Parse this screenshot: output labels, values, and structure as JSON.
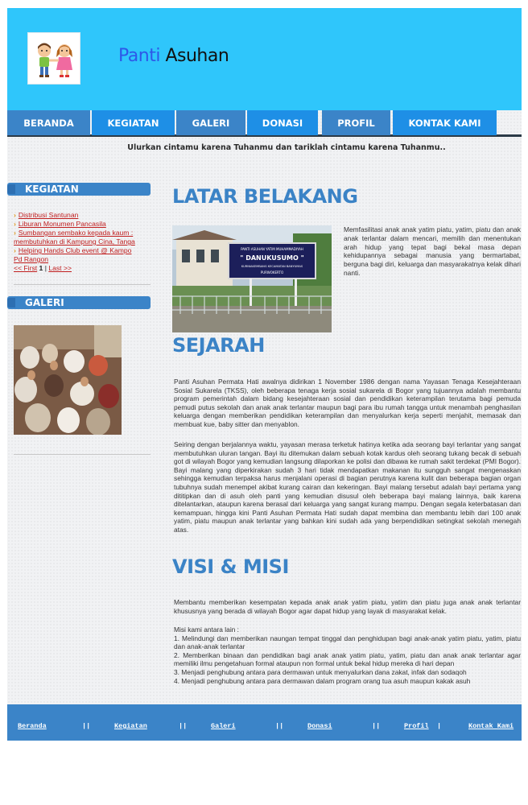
{
  "header": {
    "title_part1": "Panti",
    "title_part2": "Asuhan"
  },
  "nav": {
    "items": [
      {
        "label": "BERANDA"
      },
      {
        "label": "KEGIATAN"
      },
      {
        "label": "GALERI"
      },
      {
        "label": "DONASI"
      },
      {
        "label": "PROFIL"
      },
      {
        "label": "KONTAK KAMI"
      }
    ]
  },
  "tagline": "Ulurkan cintamu karena Tuhanmu dan tariklah cintamu karena Tuhanmu..",
  "sidebar": {
    "kegiatan_heading": "KEGIATAN",
    "kegiatan_items": [
      {
        "label": "Distribusi Santunan"
      },
      {
        "label": "Liburan Monumen Pancasila"
      },
      {
        "label": "Sumbangan sembako kepada kaum :"
      },
      {
        "label": "membutuhkan di Kampung Cina, Tanga"
      },
      {
        "label": "Helping Hands Club event @ Kampo"
      },
      {
        "label": "Pd Rangon"
      }
    ],
    "pager": {
      "first": "<< First",
      "current": "1",
      "separator": "|",
      "last": "Last >>"
    },
    "galeri_heading": "GALERI"
  },
  "main": {
    "latar": {
      "title": "LATAR BELAKANG",
      "text": "Memfasilitasi anak anak yatim piatu, yatim, piatu dan anak anak terlantar dalam mencari, memilih dan menentukan arah hidup yang tepat bagi bekal masa depan kehidupannya sebagai manusia yang bermartabat, berguna bagi diri, keluarga dan masyarakatnya kelak dihari nanti."
    },
    "sejarah": {
      "title": "SEJARAH",
      "p1": "Panti Asuhan Permata Hati awalnya didirikan 1 November 1986 dengan nama Yayasan Tenaga Kesejahteraan Sosial Sukarela (TKSS), oleh beberapa tenaga kerja sosial sukarela di Bogor yang tujuannya adalah membantu program pemerintah dalam bidang kesejahteraan sosial dan pendidikan keterampilan terutama bagi pemuda pemudi putus sekolah dan anak anak terlantar maupun bagi para ibu rumah tangga untuk menambah penghasilan keluarga dengan memberikan pendidikan keterampilan dan menyalurkan kerja seperti menjahit, memasak dan membuat kue, baby sitter dan menyablon.",
      "p2": "Seiring dengan berjalannya waktu, yayasan merasa terketuk hatinya ketika ada seorang bayi terlantar yang sangat membutuhkan uluran tangan. Bayi itu ditemukan dalam sebuah kotak kardus oleh seorang tukang becak di sebuah got di wilayah Bogor yang kemudian langsung dilaporkan ke polisi dan dibawa ke rumah sakit terdekat (PMI Bogor). Bayi malang yang diperkirakan sudah 3 hari tidak mendapatkan makanan itu sungguh sangat mengenaskan sehingga kemudian terpaksa harus menjalani operasi di bagian perutnya karena kulit dan beberapa bagian organ tubuhnya sudah menempel akibat kurang cairan dan kekeringan. Bayi malang tersebut adalah bayi pertama yang dititipkan dan di asuh oleh panti yang kemudian disusul oleh beberapa bayi malang lainnya, baik karena ditelantarkan, ataupun karena berasal dari keluarga yang sangat kurang mampu. Dengan segala keterbatasan dan kemampuan, hingga kini Panti Asuhan Permata Hati sudah dapat membina dan membantu lebih dari 100 anak yatim, piatu maupun anak terlantar yang bahkan kini sudah ada yang berpendidikan setingkat sekolah menegah atas."
    },
    "visi": {
      "title": "VISI & MISI",
      "p1": "Membantu memberikan kesempatan kepada anak anak yatim piatu, yatim dan piatu juga anak anak terlantar khususnya yang berada di wilayah Bogor agar dapat hidup yang layak di masyarakat kelak.",
      "misi_intro": "Misi kami antara lain :",
      "misi": [
        "1. Melindungi dan memberikan naungan tempat tinggal dan penghidupan bagi anak-anak yatim piatu, yatim, piatu dan anak-anak terlantar",
        "2. Memberikan binaan dan pendidikan bagi anak anak yatim piatu, yatim, piatu dan anak anak terlantar agar memiliki ilmu pengetahuan formal ataupun non formal untuk bekal hidup mereka di hari depan",
        "3. Menjadi penghubung antara para dermawan untuk menyalurkan dana zakat, infak dan sodaqoh",
        "4. Menjadi penghubung antara para dermawan dalam program orang tua asuh maupun kakak asuh"
      ]
    },
    "photo_sign": {
      "line1": "PANTI ASUHAN YATIM MUHAMMADIYAH",
      "line2": "\" DANUKUSUMO \"",
      "line3": "KURNIAKEMBANG KECAMATAN BANYUMAS",
      "line4": "PURWOKERTO"
    }
  },
  "footer": {
    "links": [
      {
        "label": "Beranda"
      },
      {
        "label": "Kegiatan"
      },
      {
        "label": "Galeri"
      },
      {
        "label": "Donasi"
      },
      {
        "label": "Profil"
      },
      {
        "label": "Kontak Kami"
      }
    ],
    "separator": "||",
    "separator_last": "|"
  },
  "colors": {
    "header_bg": "#2fc6fb",
    "nav_blue": "#3b84c8",
    "title_blue": "#3b83c6",
    "link_red": "#c11e1e"
  }
}
